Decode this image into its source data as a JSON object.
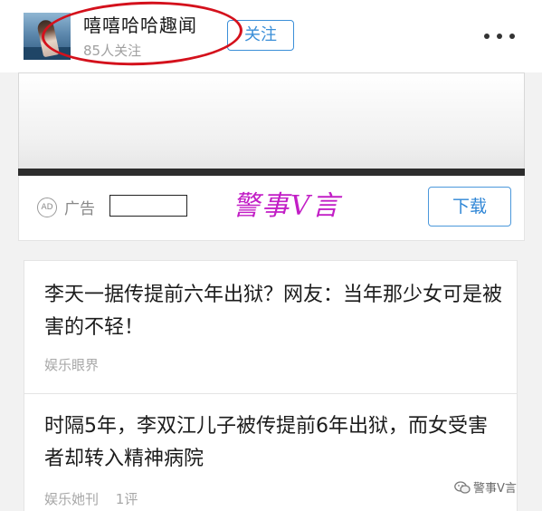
{
  "header": {
    "account_name": "嘻嘻哈哈趣闻",
    "follower_text": "85人关注",
    "follow_label": "关注",
    "more_icon": "more-dots-icon"
  },
  "ad": {
    "badge_text": "AD",
    "label": "广告",
    "download_label": "下载",
    "watermark_text": "警事V言"
  },
  "articles": [
    {
      "title": "李天一据传提前六年出狱？网友：当年那少女可是被害的不轻！",
      "source": "娱乐眼界",
      "comments": ""
    },
    {
      "title": "时隔5年，李双江儿子被传提前6年出狱，而女受害者却转入精神病院",
      "source": "娱乐她刊",
      "comments": "1评"
    }
  ],
  "footer": {
    "wechat_watermark": "警事V言"
  },
  "colors": {
    "accent_blue": "#3b8fd8",
    "annotation_red": "#d4111c",
    "watermark_magenta": "#c21ec6"
  }
}
